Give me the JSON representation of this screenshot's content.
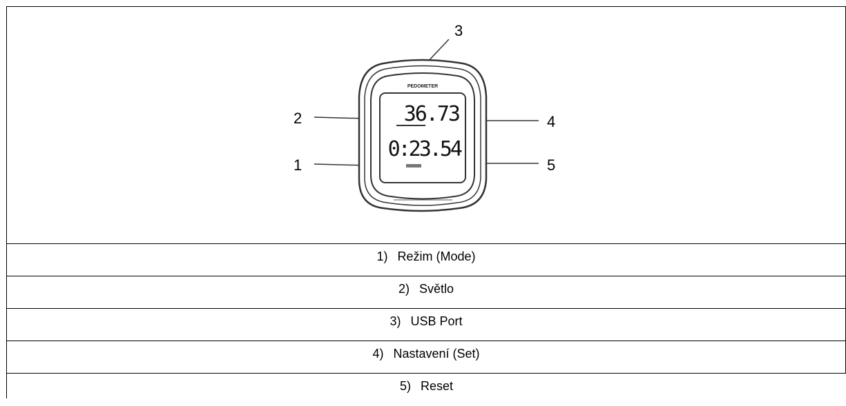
{
  "diagram": {
    "callouts": [
      "1",
      "2",
      "3",
      "4",
      "5"
    ],
    "device_brand": "PEDOMETER",
    "display_top": "36.73",
    "display_bottom": "0:23.54"
  },
  "legend": {
    "items": [
      {
        "num": "1)",
        "label": "Režim (Mode)"
      },
      {
        "num": "2)",
        "label": "Světlo"
      },
      {
        "num": "3)",
        "label": "USB Port"
      },
      {
        "num": "4)",
        "label": "Nastavení (Set)"
      },
      {
        "num": "5)",
        "label": "Reset"
      }
    ]
  }
}
